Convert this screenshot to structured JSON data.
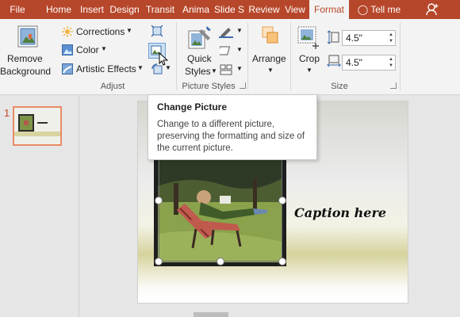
{
  "tabs": [
    {
      "label": "File"
    },
    {
      "label": "Home"
    },
    {
      "label": "Insert"
    },
    {
      "label": "Design"
    },
    {
      "label": "Transit"
    },
    {
      "label": "Anima"
    },
    {
      "label": "Slide S"
    },
    {
      "label": "Review"
    },
    {
      "label": "View"
    },
    {
      "label": "Format"
    },
    {
      "label": "Tell me"
    }
  ],
  "ribbon": {
    "remove_background": [
      "Remove",
      "Background"
    ],
    "corrections": "Corrections",
    "color": "Color",
    "artistic_effects": "Artistic Effects",
    "quick_styles": [
      "Quick",
      "Styles"
    ],
    "arrange": "Arrange",
    "crop": "Crop",
    "height_value": "4.5\"",
    "width_value": "4.5\"",
    "groups": {
      "adjust": "Adjust",
      "picture_styles": "Picture Styles",
      "size": "Size"
    }
  },
  "slides_pane": {
    "slide_number": "1"
  },
  "slide": {
    "caption": "Caption here"
  },
  "tooltip": {
    "title": "Change Picture",
    "body": "Change to a different picture, preserving the formatting and size of the current picture."
  },
  "colors": {
    "accent": "#b7472a",
    "ribbon_bg": "#f3f3f3",
    "workspace": "#e6e6e6"
  }
}
